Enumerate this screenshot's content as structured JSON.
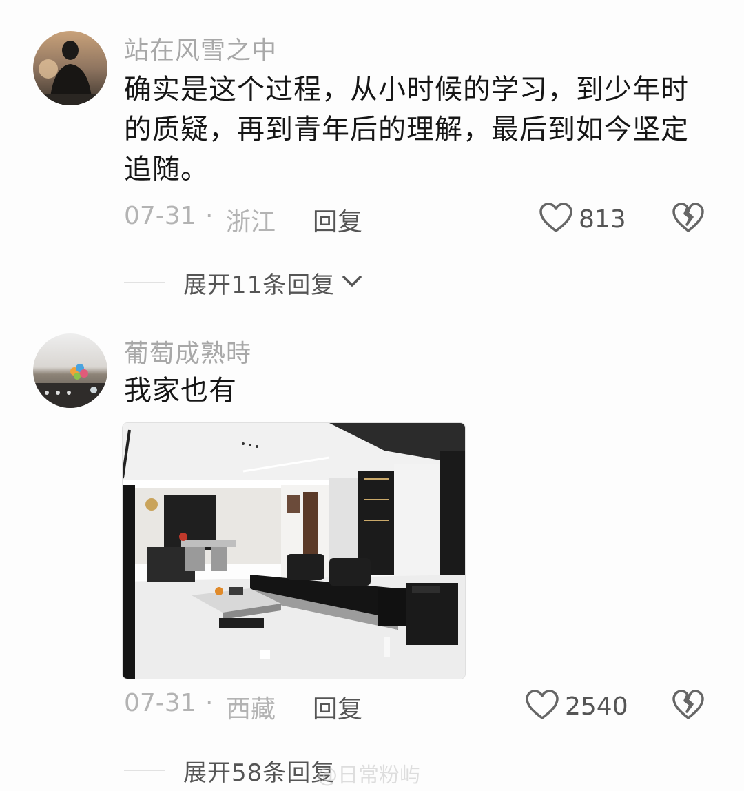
{
  "comments": [
    {
      "username": "站在风雪之中",
      "text": "确实是这个过程，从小时候的学习，到少年时的质疑，再到青年后的理解，最后到如今坚定追随。",
      "date": "07-31",
      "separator": "·",
      "location": "浙江",
      "reply_label": "回复",
      "likes": "813",
      "expand_label": "展开11条回复"
    },
    {
      "username": "葡萄成熟時",
      "text": "我家也有",
      "date": "07-31",
      "separator": "·",
      "location": "西藏",
      "reply_label": "回复",
      "likes": "2540",
      "expand_label": "展开58条回复"
    }
  ],
  "watermark": "@日常粉屿",
  "icons": {
    "like": "heart-outline-icon",
    "dislike": "broken-heart-icon",
    "expand": "chevron-down-icon"
  },
  "colors": {
    "text": "#161616",
    "muted": "#a8a8a8",
    "action": "#555555",
    "background": "#fdfdfd"
  }
}
